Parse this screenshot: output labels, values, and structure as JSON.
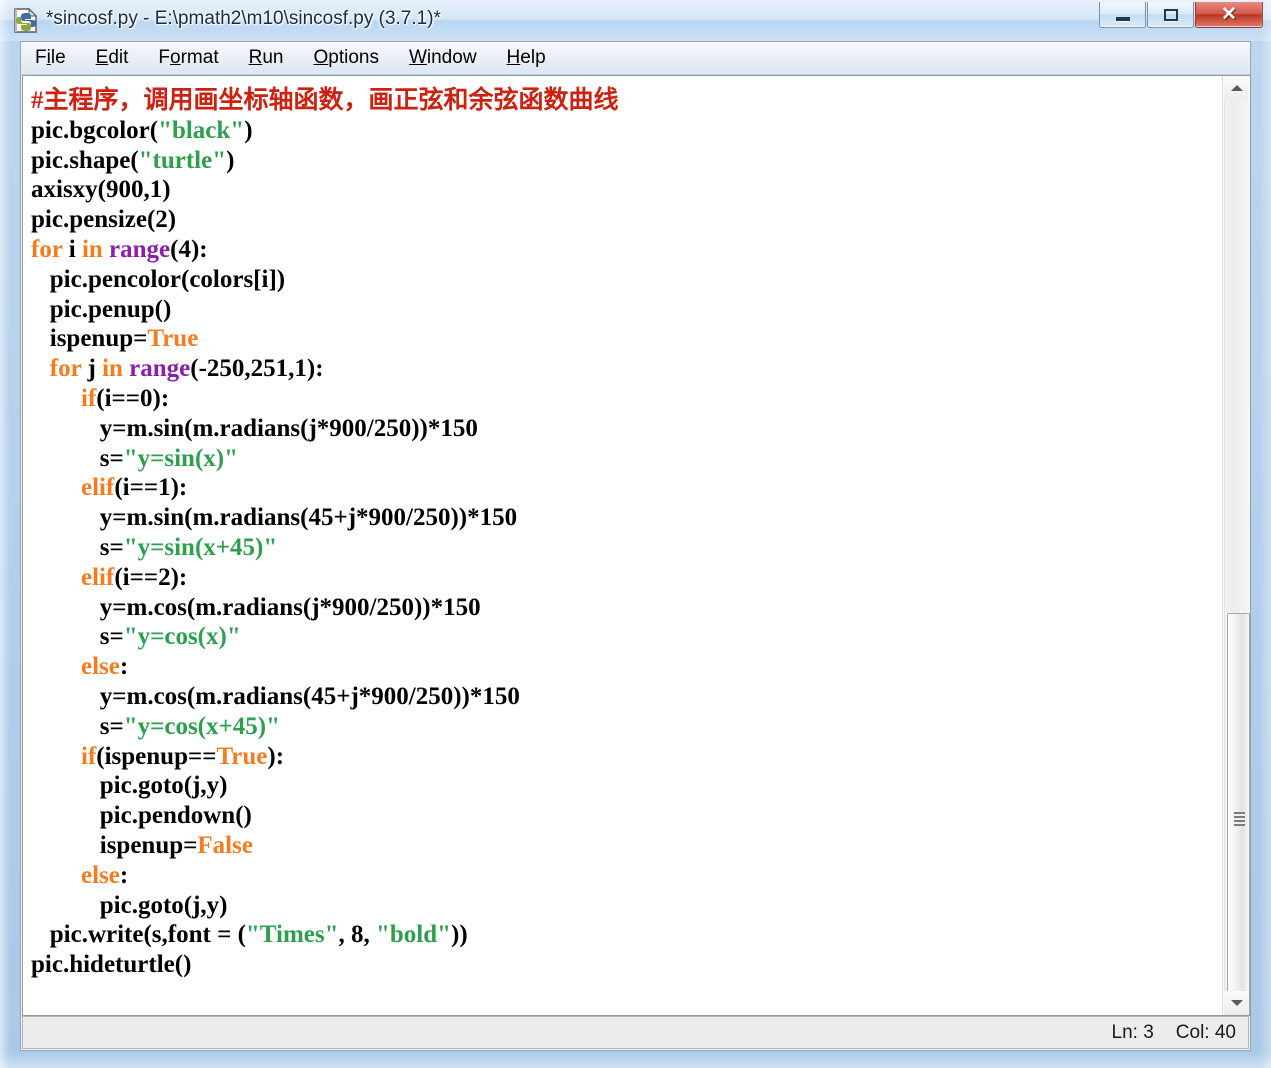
{
  "window": {
    "title": "*sincosf.py - E:\\pmath2\\m10\\sincosf.py (3.7.1)*",
    "icon": "python-idle-icon",
    "controls": {
      "minimize": "minimize-icon",
      "maximize": "maximize-icon",
      "close": "✕"
    }
  },
  "menubar": {
    "items": [
      {
        "pre": "F",
        "key": "i",
        "post": "le"
      },
      {
        "pre": "",
        "key": "E",
        "post": "dit"
      },
      {
        "pre": "F",
        "key": "o",
        "post": "rmat"
      },
      {
        "pre": "",
        "key": "R",
        "post": "un"
      },
      {
        "pre": "",
        "key": "O",
        "post": "ptions"
      },
      {
        "pre": "",
        "key": "W",
        "post": "indow"
      },
      {
        "pre": "",
        "key": "H",
        "post": "elp"
      }
    ]
  },
  "editor": {
    "lines": [
      [
        {
          "t": "#主程序，调用画坐标轴函数，画正弦和余弦函数曲线",
          "c": "comment"
        }
      ],
      [
        {
          "t": "pic.bgcolor(",
          "c": "plain"
        },
        {
          "t": "\"black\"",
          "c": "string"
        },
        {
          "t": ")",
          "c": "plain"
        }
      ],
      [
        {
          "t": "pic.shape(",
          "c": "plain"
        },
        {
          "t": "\"turtle\"",
          "c": "string"
        },
        {
          "t": ")",
          "c": "plain"
        }
      ],
      [
        {
          "t": "axisxy(900,1)",
          "c": "plain"
        }
      ],
      [
        {
          "t": "pic.pensize(2)",
          "c": "plain"
        }
      ],
      [
        {
          "t": "for",
          "c": "kw"
        },
        {
          "t": " i ",
          "c": "plain"
        },
        {
          "t": "in",
          "c": "kw"
        },
        {
          "t": " ",
          "c": "plain"
        },
        {
          "t": "range",
          "c": "builtin"
        },
        {
          "t": "(4):",
          "c": "plain"
        }
      ],
      [
        {
          "t": "   pic.pencolor(colors[i])",
          "c": "plain"
        }
      ],
      [
        {
          "t": "   pic.penup()",
          "c": "plain"
        }
      ],
      [
        {
          "t": "   ispenup=",
          "c": "plain"
        },
        {
          "t": "True",
          "c": "kw"
        }
      ],
      [
        {
          "t": "   ",
          "c": "plain"
        },
        {
          "t": "for",
          "c": "kw"
        },
        {
          "t": " j ",
          "c": "plain"
        },
        {
          "t": "in",
          "c": "kw"
        },
        {
          "t": " ",
          "c": "plain"
        },
        {
          "t": "range",
          "c": "builtin"
        },
        {
          "t": "(-250,251,1):",
          "c": "plain"
        }
      ],
      [
        {
          "t": "        ",
          "c": "plain"
        },
        {
          "t": "if",
          "c": "kw"
        },
        {
          "t": "(i==0):",
          "c": "plain"
        }
      ],
      [
        {
          "t": "           y=m.sin(m.radians(j*900/250))*150",
          "c": "plain"
        }
      ],
      [
        {
          "t": "           s=",
          "c": "plain"
        },
        {
          "t": "\"y=sin(x)\"",
          "c": "string"
        }
      ],
      [
        {
          "t": "        ",
          "c": "plain"
        },
        {
          "t": "elif",
          "c": "kw"
        },
        {
          "t": "(i==1):",
          "c": "plain"
        }
      ],
      [
        {
          "t": "           y=m.sin(m.radians(45+j*900/250))*150",
          "c": "plain"
        }
      ],
      [
        {
          "t": "           s=",
          "c": "plain"
        },
        {
          "t": "\"y=sin(x+45)\"",
          "c": "string"
        }
      ],
      [
        {
          "t": "        ",
          "c": "plain"
        },
        {
          "t": "elif",
          "c": "kw"
        },
        {
          "t": "(i==2):",
          "c": "plain"
        }
      ],
      [
        {
          "t": "           y=m.cos(m.radians(j*900/250))*150",
          "c": "plain"
        }
      ],
      [
        {
          "t": "           s=",
          "c": "plain"
        },
        {
          "t": "\"y=cos(x)\"",
          "c": "string"
        }
      ],
      [
        {
          "t": "        ",
          "c": "plain"
        },
        {
          "t": "else",
          "c": "kw"
        },
        {
          "t": ":",
          "c": "plain"
        }
      ],
      [
        {
          "t": "           y=m.cos(m.radians(45+j*900/250))*150",
          "c": "plain"
        }
      ],
      [
        {
          "t": "           s=",
          "c": "plain"
        },
        {
          "t": "\"y=cos(x+45)\"",
          "c": "string"
        }
      ],
      [
        {
          "t": "        ",
          "c": "plain"
        },
        {
          "t": "if",
          "c": "kw"
        },
        {
          "t": "(ispenup==",
          "c": "plain"
        },
        {
          "t": "True",
          "c": "kw"
        },
        {
          "t": "):",
          "c": "plain"
        }
      ],
      [
        {
          "t": "           pic.goto(j,y)",
          "c": "plain"
        }
      ],
      [
        {
          "t": "           pic.pendown()",
          "c": "plain"
        }
      ],
      [
        {
          "t": "           ispenup=",
          "c": "plain"
        },
        {
          "t": "False",
          "c": "kw"
        }
      ],
      [
        {
          "t": "        ",
          "c": "plain"
        },
        {
          "t": "else",
          "c": "kw"
        },
        {
          "t": ":",
          "c": "plain"
        }
      ],
      [
        {
          "t": "           pic.goto(j,y)",
          "c": "plain"
        }
      ],
      [
        {
          "t": "   pic.write(s,font = (",
          "c": "plain"
        },
        {
          "t": "\"Times\"",
          "c": "string"
        },
        {
          "t": ", 8, ",
          "c": "plain"
        },
        {
          "t": "\"bold\"",
          "c": "string"
        },
        {
          "t": "))",
          "c": "plain"
        }
      ],
      [
        {
          "t": "pic.hideturtle()",
          "c": "plain"
        }
      ]
    ],
    "colors": {
      "comment": "#cc2211",
      "string": "#2e9e4f",
      "keyword": "#f57c20",
      "builtin": "#8b1fa9",
      "plain": "#000000",
      "background": "#ffffff"
    }
  },
  "scrollbar": {
    "up_arrow": "chevron-up-icon",
    "down_arrow": "chevron-down-icon",
    "grip": "scrollbar-grip-icon"
  },
  "statusbar": {
    "line_label": "Ln: 3",
    "col_label": "Col: 40"
  }
}
